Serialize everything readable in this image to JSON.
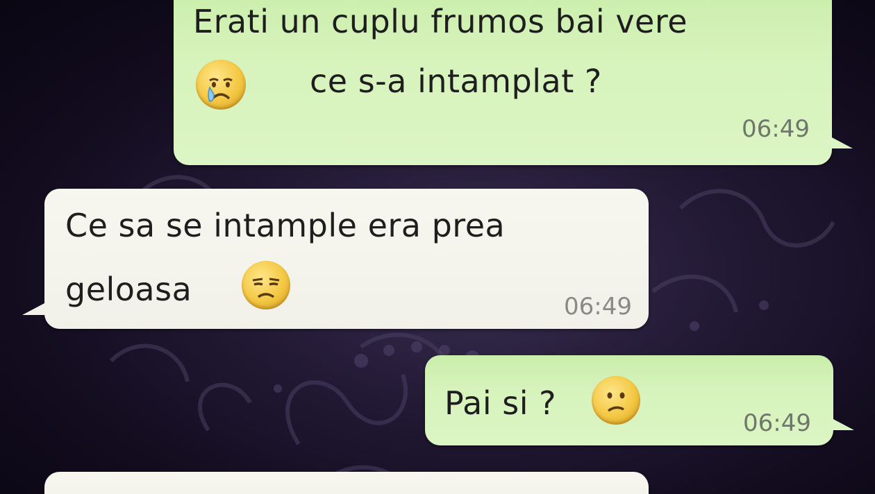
{
  "chat": {
    "messages": [
      {
        "direction": "outgoing",
        "line1": "Erati un cuplu frumos bai vere",
        "line2": "ce s-a intamplat ?",
        "emoji": "crying-face-icon",
        "time": "06:49"
      },
      {
        "direction": "incoming",
        "line1": "Ce sa se intample era prea",
        "line2": "geloasa",
        "emoji": "unamused-face-icon",
        "time": "06:49"
      },
      {
        "direction": "outgoing",
        "line1": "Pai si ?",
        "emoji": "confused-face-icon",
        "time": "06:49"
      }
    ]
  },
  "colors": {
    "outgoing_bubble": "#dcf5c4",
    "incoming_bubble": "#f1f1e9",
    "background": "#1a1228"
  }
}
